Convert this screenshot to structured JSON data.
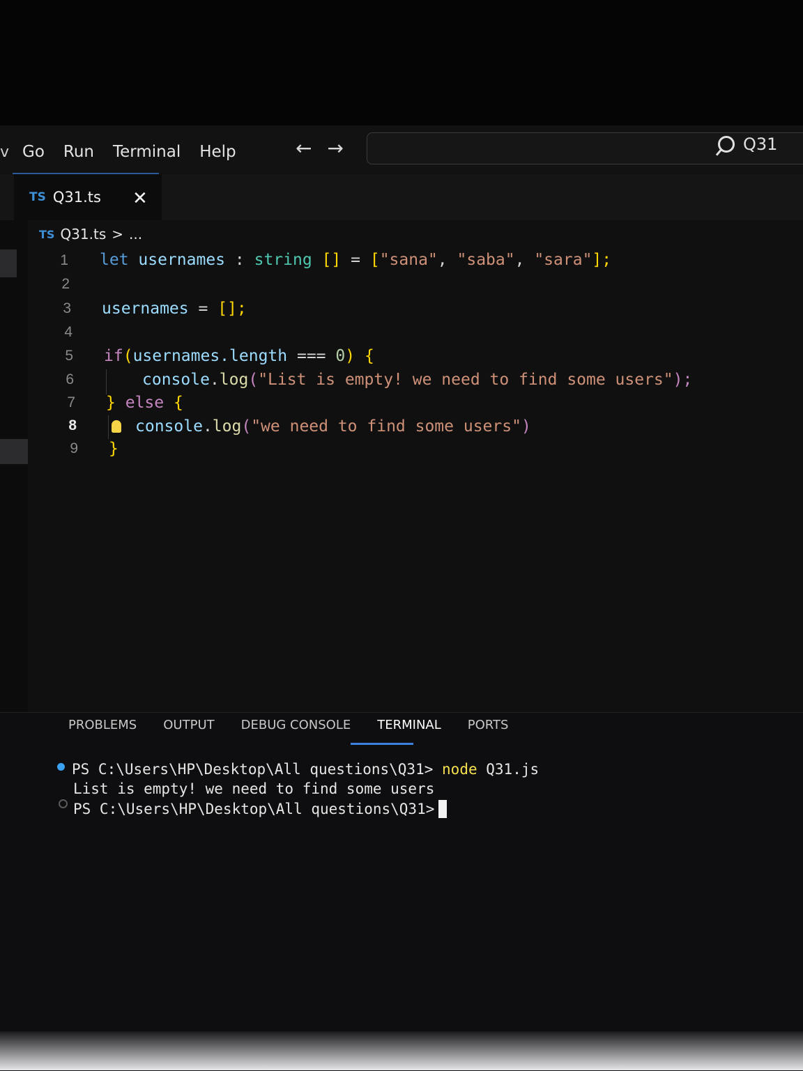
{
  "menu": {
    "clipped_item": "v",
    "items": [
      "Go",
      "Run",
      "Terminal",
      "Help"
    ]
  },
  "nav": {
    "back_icon": "←",
    "forward_icon": "→"
  },
  "command_center": {
    "text": "Q31"
  },
  "editor_tab": {
    "badge": "TS",
    "label": "Q31.ts",
    "close": "✕"
  },
  "breadcrumb": {
    "badge": "TS",
    "file": "Q31.ts",
    "separator": ">",
    "more": "..."
  },
  "code": {
    "line_numbers": [
      "1",
      "2",
      "3",
      "4",
      "5",
      "6",
      "7",
      "8",
      "9"
    ],
    "active_line": "8",
    "l1": {
      "let": "let",
      "name": "usernames",
      "colon": ":",
      "type": "string",
      "arr": "[]",
      "eq": "=",
      "open": "[",
      "s1": "\"sana\"",
      "c1": ",",
      "s2": "\"saba\"",
      "c2": ",",
      "s3": "\"sara\"",
      "close": "];"
    },
    "l3": {
      "name": "usernames",
      "eq": "=",
      "val": "[];"
    },
    "l5": {
      "if": "if",
      "paren": "(",
      "expr": "usernames.length",
      "op": "===",
      "num": "0",
      "close": ")",
      "brace": "{"
    },
    "l6": {
      "obj": "console",
      "dot": ".",
      "fn": "log",
      "open": "(",
      "str": "\"List is empty! we need to find some users\"",
      "close": ");"
    },
    "l7": {
      "brace1": "}",
      "else": "else",
      "brace2": "{"
    },
    "l8": {
      "obj": "console",
      "dot": ".",
      "fn": "log",
      "open": "(",
      "str": "\"we need to find some users\"",
      "close": ")"
    },
    "l9": {
      "brace": "}"
    }
  },
  "panel": {
    "tabs": [
      "PROBLEMS",
      "OUTPUT",
      "DEBUG CONSOLE",
      "TERMINAL",
      "PORTS"
    ],
    "active_tab": "TERMINAL"
  },
  "terminal": {
    "prompt1": "PS C:\\Users\\HP\\Desktop\\All questions\\Q31>",
    "cmd": "node",
    "arg": "Q31.js",
    "output": "List is empty! we need to find some users",
    "prompt2": "PS C:\\Users\\HP\\Desktop\\All questions\\Q31>"
  },
  "colors": {
    "keyword": "#569cd6",
    "variable": "#9cdcfe",
    "type": "#4ec9b0",
    "bracket": "#ffd700",
    "string": "#ce9178",
    "function": "#dcdcaa",
    "number": "#b5cea8",
    "accent": "#3b82e0"
  }
}
